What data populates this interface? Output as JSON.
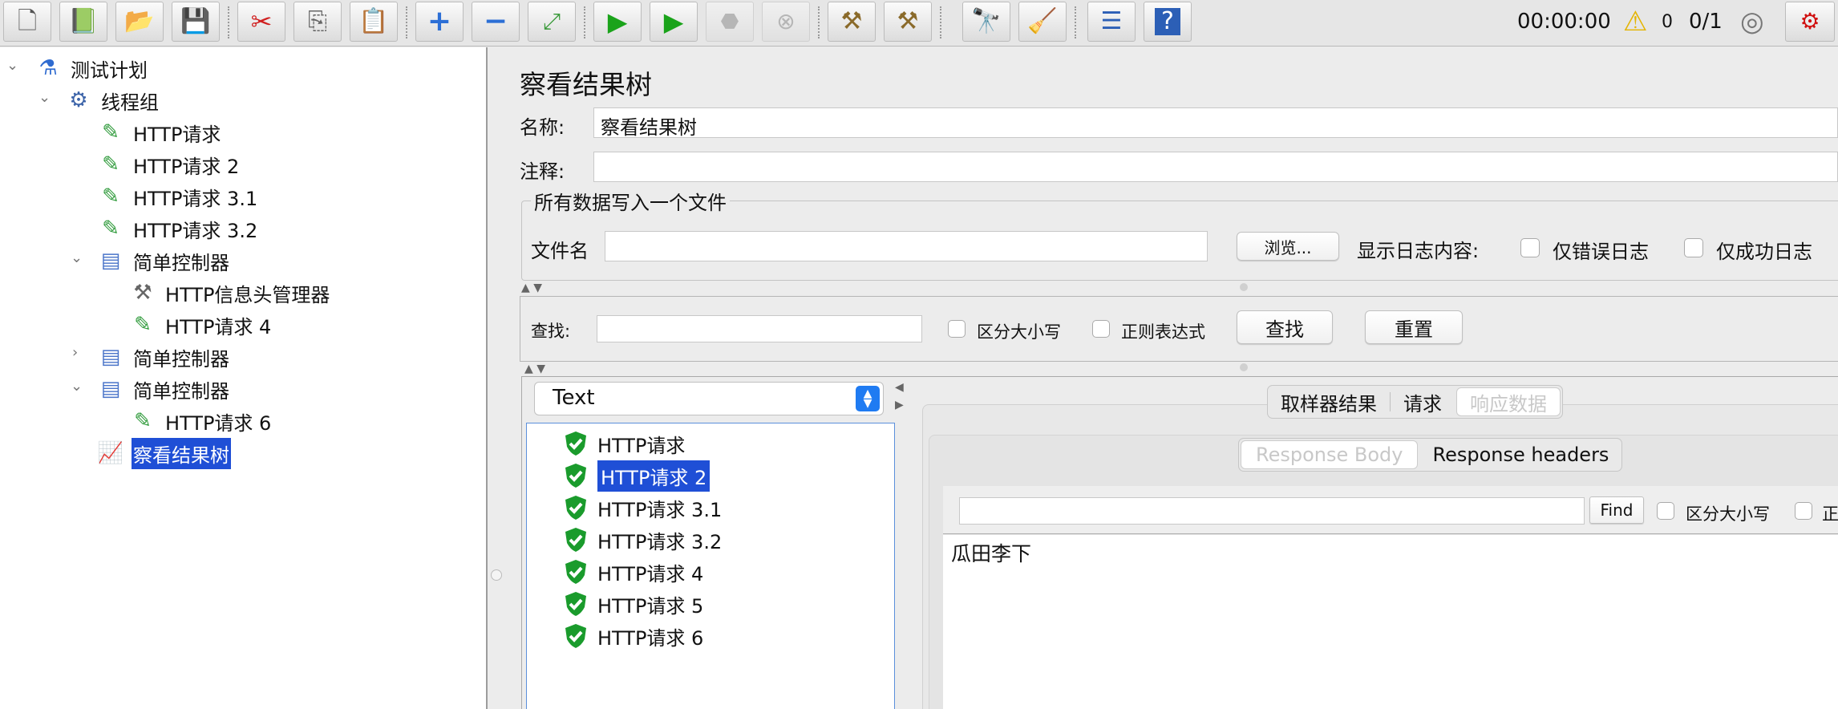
{
  "toolbar": {
    "elapsed_time": "00:00:00",
    "warning_count": "0",
    "threads_ratio": "0/1",
    "icons": [
      "new-icon",
      "templates-icon",
      "open-icon",
      "save-icon",
      "cut-icon",
      "copy-icon",
      "paste-icon",
      "expand-icon",
      "collapse-icon",
      "toggle-icon",
      "start-icon",
      "start-no-pause-icon",
      "stop-icon",
      "shutdown-icon",
      "clear-icon",
      "clear-all-icon",
      "search-icon",
      "reset-search-icon",
      "function-helper-icon",
      "help-icon"
    ]
  },
  "tree": {
    "items": [
      {
        "label": "测试计划",
        "icon": "test-plan-icon"
      },
      {
        "label": "线程组",
        "icon": "thread-group-icon"
      },
      {
        "label": "HTTP请求",
        "icon": "sampler-icon"
      },
      {
        "label": "HTTP请求 2",
        "icon": "sampler-icon"
      },
      {
        "label": "HTTP请求 3.1",
        "icon": "sampler-icon"
      },
      {
        "label": "HTTP请求 3.2",
        "icon": "sampler-icon"
      },
      {
        "label": "简单控制器",
        "icon": "controller-icon"
      },
      {
        "label": "HTTP信息头管理器",
        "icon": "config-tools-icon"
      },
      {
        "label": "HTTP请求 4",
        "icon": "sampler-icon"
      },
      {
        "label": "简单控制器",
        "icon": "controller-icon"
      },
      {
        "label": "简单控制器",
        "icon": "controller-icon"
      },
      {
        "label": "HTTP请求 6",
        "icon": "sampler-icon"
      },
      {
        "label": "察看结果树",
        "icon": "listener-icon"
      }
    ]
  },
  "panel": {
    "title": "察看结果树",
    "name_label": "名称:",
    "name_value": "察看结果树",
    "comment_label": "注释:",
    "comment_value": "",
    "file_group_legend": "所有数据写入一个文件",
    "filename_label": "文件名",
    "filename_value": "",
    "browse_button": "浏览...",
    "log_content_label": "显示日志内容:",
    "errors_only": "仅错误日志",
    "success_only": "仅成功日志"
  },
  "search": {
    "label": "查找:",
    "value": "",
    "case_sensitive": "区分大小写",
    "regex": "正则表达式",
    "find_button": "查找",
    "reset_button": "重置"
  },
  "results": {
    "renderer": "Text",
    "items": [
      "HTTP请求",
      "HTTP请求 2",
      "HTTP请求 3.1",
      "HTTP请求 3.2",
      "HTTP请求 4",
      "HTTP请求 5",
      "HTTP请求 6"
    ],
    "selected_index": 1
  },
  "detail": {
    "tabs": [
      "取样器结果",
      "请求",
      "响应数据"
    ],
    "active_tab": 2,
    "sub_tabs": [
      "Response Body",
      "Response headers"
    ],
    "active_sub_tab": 0,
    "find_value": "",
    "find_button": "Find",
    "case_sensitive": "区分大小写",
    "regex_truncated": "正",
    "response_text": "瓜田李下"
  },
  "colors": {
    "selection": "#1f4fd6",
    "success_shield": "#1a9b2c",
    "select_accent": "#1f7bf2"
  }
}
